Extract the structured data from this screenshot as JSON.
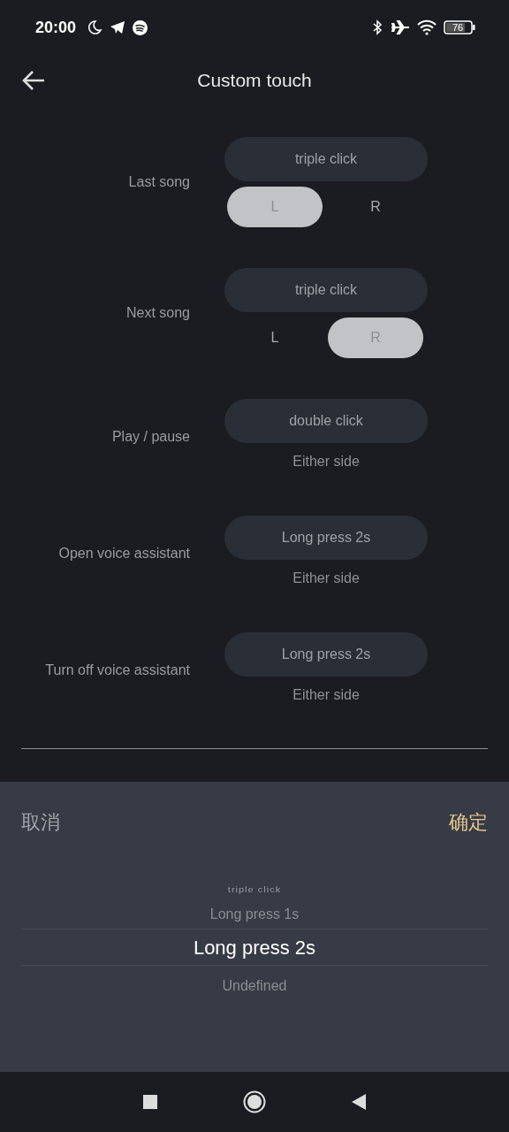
{
  "status_bar": {
    "time": "20:00",
    "battery": "76"
  },
  "header": {
    "title": "Custom touch"
  },
  "gestures": [
    {
      "label": "Last song",
      "action": "triple click",
      "side": {
        "kind": "lr",
        "options": [
          {
            "label": "L",
            "selected": true
          },
          {
            "label": "R",
            "selected": false
          }
        ]
      }
    },
    {
      "label": "Next song",
      "action": "triple click",
      "side": {
        "kind": "lr",
        "options": [
          {
            "label": "L",
            "selected": false
          },
          {
            "label": "R",
            "selected": true
          }
        ]
      }
    },
    {
      "label": "Play / pause",
      "action": "double click",
      "side": {
        "kind": "text",
        "text": "Either side"
      }
    },
    {
      "label": "Open voice assistant",
      "action": "Long press 2s",
      "side": {
        "kind": "text",
        "text": "Either side"
      }
    },
    {
      "label": "Turn off voice assistant",
      "action": "Long press 2s",
      "side": {
        "kind": "text",
        "text": "Either side"
      }
    }
  ],
  "picker": {
    "cancel": "取消",
    "confirm": "确定",
    "options": [
      {
        "label": "triple click",
        "selected": false
      },
      {
        "label": "Long press 1s",
        "selected": false
      },
      {
        "label": "Long press 2s",
        "selected": true
      },
      {
        "label": "Undefined",
        "selected": false
      }
    ]
  }
}
